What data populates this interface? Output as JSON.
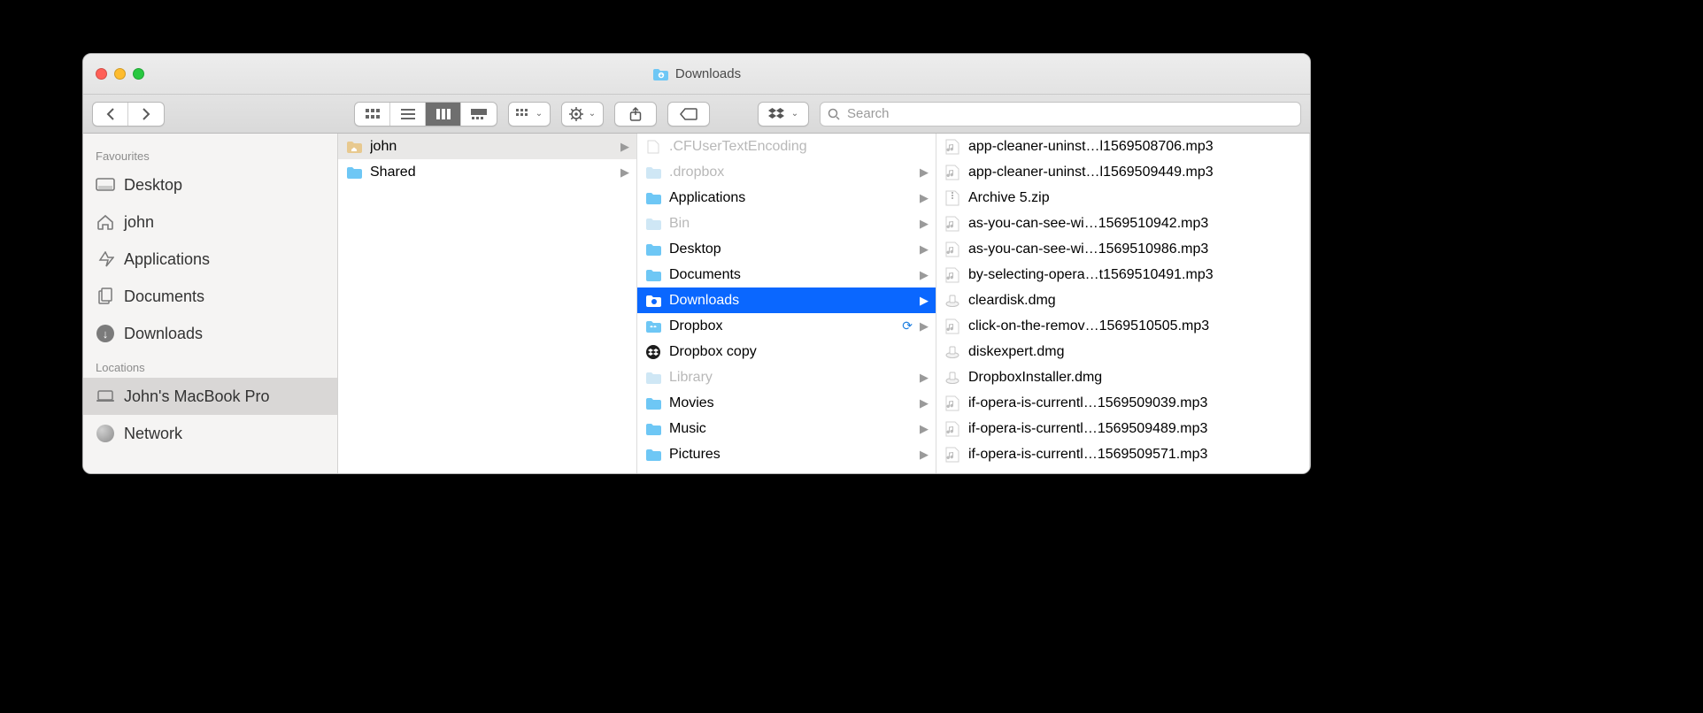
{
  "window": {
    "title": "Downloads"
  },
  "toolbar": {
    "search_placeholder": "Search"
  },
  "sidebar": {
    "favourites_header": "Favourites",
    "locations_header": "Locations",
    "favourites": [
      {
        "name": "Desktop",
        "icon": "desktop"
      },
      {
        "name": "john",
        "icon": "home"
      },
      {
        "name": "Applications",
        "icon": "apps"
      },
      {
        "name": "Documents",
        "icon": "docs"
      },
      {
        "name": "Downloads",
        "icon": "downloads"
      }
    ],
    "locations": [
      {
        "name": "John's MacBook Pro",
        "icon": "laptop",
        "selected": true
      },
      {
        "name": "Network",
        "icon": "network"
      }
    ]
  },
  "columns": [
    [
      {
        "name": "john",
        "icon": "home-folder",
        "arrow": true,
        "state": "gray-selected"
      },
      {
        "name": "Shared",
        "icon": "folder",
        "arrow": true
      }
    ],
    [
      {
        "name": ".CFUserTextEncoding",
        "icon": "file-dim",
        "dim": true
      },
      {
        "name": ".dropbox",
        "icon": "folder-dim",
        "dim": true,
        "arrow": true
      },
      {
        "name": "Applications",
        "icon": "folder",
        "arrow": true
      },
      {
        "name": "Bin",
        "icon": "folder-dim",
        "dim": true,
        "arrow": true
      },
      {
        "name": "Desktop",
        "icon": "folder",
        "arrow": true
      },
      {
        "name": "Documents",
        "icon": "folder",
        "arrow": true
      },
      {
        "name": "Downloads",
        "icon": "downloads-folder-white",
        "arrow": true,
        "state": "blue-selected"
      },
      {
        "name": "Dropbox",
        "icon": "dropbox-folder",
        "arrow": true,
        "sync": true
      },
      {
        "name": "Dropbox copy",
        "icon": "dropbox-app"
      },
      {
        "name": "Library",
        "icon": "folder-dim",
        "dim": true,
        "arrow": true
      },
      {
        "name": "Movies",
        "icon": "folder",
        "arrow": true
      },
      {
        "name": "Music",
        "icon": "folder",
        "arrow": true
      },
      {
        "name": "Pictures",
        "icon": "folder",
        "arrow": true
      }
    ],
    [
      {
        "name": "app-cleaner-uninst…l1569508706.mp3",
        "icon": "audio"
      },
      {
        "name": "app-cleaner-uninst…l1569509449.mp3",
        "icon": "audio"
      },
      {
        "name": "Archive 5.zip",
        "icon": "zip"
      },
      {
        "name": "as-you-can-see-wi…1569510942.mp3",
        "icon": "audio"
      },
      {
        "name": "as-you-can-see-wi…1569510986.mp3",
        "icon": "audio"
      },
      {
        "name": "by-selecting-opera…t1569510491.mp3",
        "icon": "audio"
      },
      {
        "name": "cleardisk.dmg",
        "icon": "dmg"
      },
      {
        "name": "click-on-the-remov…1569510505.mp3",
        "icon": "audio"
      },
      {
        "name": "diskexpert.dmg",
        "icon": "dmg"
      },
      {
        "name": "DropboxInstaller.dmg",
        "icon": "dmg"
      },
      {
        "name": "if-opera-is-currentl…1569509039.mp3",
        "icon": "audio"
      },
      {
        "name": "if-opera-is-currentl…1569509489.mp3",
        "icon": "audio"
      },
      {
        "name": "if-opera-is-currentl…1569509571.mp3",
        "icon": "audio"
      }
    ]
  ]
}
